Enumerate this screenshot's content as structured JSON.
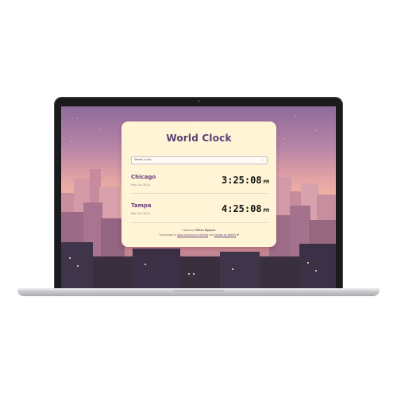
{
  "app": {
    "title": "World Clock",
    "select_placeholder": "Select a city"
  },
  "cities": [
    {
      "name": "Chicago",
      "date": "May 1st 2024",
      "time": "3:25:08",
      "ampm": "PM"
    },
    {
      "name": "Tampa",
      "date": "May 1st 2024",
      "time": "4:25:08",
      "ampm": "PM"
    }
  ],
  "footer": {
    "credit_prefix": "Coded by",
    "author": "Vivian Nguyen",
    "line2_prefix": "This project is",
    "link1": "open-sourced on GitHub",
    "line2_mid": "and",
    "link2": "hosted on Netlify",
    "heart_icon": "♥"
  },
  "colors": {
    "card_bg": "#fff5d6",
    "title": "#5b3f74",
    "city_name": "#6a3f7c"
  }
}
